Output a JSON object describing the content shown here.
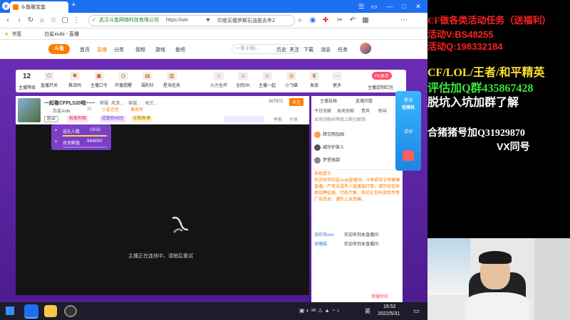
{
  "browser": {
    "tab_title": "斗鱼暖宝盒",
    "url_host": "武汉斗鱼网络科技有限公司",
    "url_path": "https://ww",
    "search_hint": "印度买俄罗斯石油是去年2",
    "bookmarks": [
      "书签",
      "白鲨xiubi - 直播"
    ]
  },
  "site": {
    "logo": "斗鱼",
    "nav": [
      "首页",
      "直播",
      "分类",
      "视频",
      "游戏",
      "鱼吧"
    ],
    "search_placeholder": "一条小明...",
    "user_items": [
      "历史",
      "关注",
      "下载",
      "消息",
      "任务"
    ]
  },
  "toolbar": {
    "level": "12",
    "items": [
      "主播等级",
      "直播开关",
      "推流码",
      "主播口令",
      "开播提醒",
      "福利社",
      "星海任务",
      "火力全开",
      "全民PK",
      "主播一起",
      "小飞碟",
      "发放",
      "更多"
    ],
    "right_label": "主播定制红包",
    "right_badge": "PK高手"
  },
  "room": {
    "title": "一起看CFPLS20啦~~~",
    "tags": [
      "帮服",
      "风游...",
      "穿越...",
      "枪王..."
    ],
    "streamer": "白鲨xiubi",
    "followers": "32",
    "family": "小鲨豆豆",
    "union": "事务所",
    "viewers": "307972",
    "follow_btn": "关注",
    "report": "举报",
    "share": "分享",
    "level_tag": "粉丝",
    "badges": [
      "稻草狗窝",
      "超管粉丝团",
      "初期鱼塘"
    ]
  },
  "popup": {
    "row1_label": "送礼人数",
    "row1_value": "15/15",
    "row2_label": "总贡献值",
    "row2_value": "94/6000"
  },
  "video": {
    "status": "主播正在连线中，请稍后重试"
  },
  "chat": {
    "tabs": [
      "主播投稿",
      "直播回看",
      "今日贡献",
      "本周贡献",
      "贵宾",
      "粉丝"
    ],
    "notice": "本房间粉丝等级上限已解锁",
    "users": [
      "降甘雨加固",
      "威仔护某人",
      "梦里很甜"
    ],
    "system_label": "系统提示",
    "system_text": "欢迎来到白鲨xiubi直播间。斗鱼倡导文明健康直播，严禁未成年人直播或打赏。请勿轻信各类招聘征婚、代练代售、购买礼包码游戏币等广告信息，谨防上当受骗。",
    "welcome1_user": "且听风ovo",
    "welcome1_text": "欢迎来到本直播间",
    "welcome2_user": "池塘森",
    "welcome2_text": "欢迎来到本直播间",
    "bottom_label": "荣耀特权"
  },
  "sidead": {
    "line1": "星海",
    "line2": "扭蛋机",
    "line3": "活动"
  },
  "taskbar": {
    "time": "16:52",
    "date": "2022/5/31",
    "lang": "英"
  },
  "overlay": {
    "line1": "CF做各类活动任务（送福利）",
    "line2": "活动V:BS48255",
    "line3": "活动Q:198332184",
    "line4": "CF/LOL/王者/和平精英",
    "line5": "评估加Q群435867428",
    "line6": "脱坑入坑加群了解",
    "line7": "合猪猪号加Q31929870",
    "line8": "VX同号"
  },
  "colors": {
    "brand_orange": "#ff7a00",
    "purple_bg": "#5a23a0",
    "overlay_red": "#ff2020",
    "overlay_yellow": "#ffe030",
    "overlay_green": "#38e838",
    "overlay_white": "#ffffff"
  }
}
